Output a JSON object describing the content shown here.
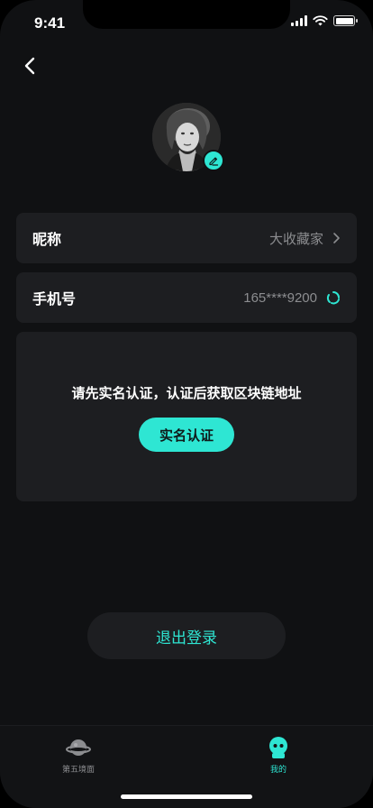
{
  "status_bar": {
    "time": "9:41"
  },
  "profile": {
    "nickname_label": "昵称",
    "nickname_value": "大收藏家",
    "phone_label": "手机号",
    "phone_value": "165****9200"
  },
  "verification": {
    "prompt": "请先实名认证，认证后获取区块链地址",
    "button_label": "实名认证"
  },
  "logout_label": "退出登录",
  "tab_bar": {
    "tabs": [
      {
        "label": "第五境面",
        "icon": "planet-icon",
        "active": false
      },
      {
        "label": "我的",
        "icon": "robot-face-icon",
        "active": true
      }
    ]
  },
  "colors": {
    "accent": "#2ee6d3",
    "background": "#101113",
    "card": "#1d1e21",
    "muted_text": "#8c8d90"
  }
}
